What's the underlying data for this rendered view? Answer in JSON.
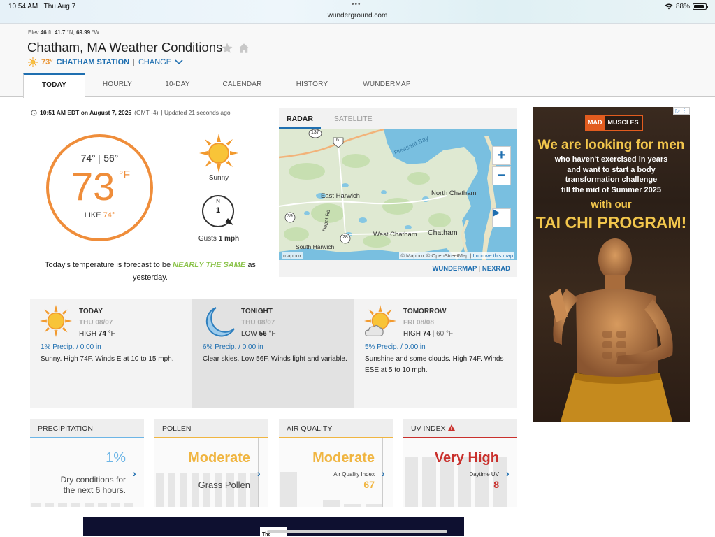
{
  "status_bar": {
    "time": "10:54 AM",
    "date": "Thu Aug 7",
    "url": "wunderground.com",
    "battery": "88%",
    "battery_level": 0.88
  },
  "header": {
    "elev_label": "Elev",
    "elev_value": "46",
    "elev_unit": "ft,",
    "lat": "41.7",
    "lat_unit": "°N,",
    "lon": "69.99",
    "lon_unit": "°W",
    "title": "Chatham, MA Weather Conditions",
    "station_temp": "73°",
    "station_name": "CHATHAM STATION",
    "station_sep": "|",
    "change_label": "CHANGE"
  },
  "tabs": [
    "TODAY",
    "HOURLY",
    "10-DAY",
    "CALENDAR",
    "HISTORY",
    "WUNDERMAP"
  ],
  "current": {
    "updated_time": "10:51 AM EDT on August 7, 2025",
    "tz": "(GMT -4)",
    "updated_ago": "| Updated 21 seconds ago",
    "high": "74°",
    "sep": "|",
    "low": "56°",
    "temp": "73",
    "unit": "°F",
    "like_label": "LIKE",
    "like_value": "74°",
    "condition": "Sunny",
    "wind_dir": "N",
    "wind_speed": "1",
    "gusts_label": "Gusts",
    "gusts_value": "1 mph",
    "note_pre": "Today's temperature is forecast to be",
    "note_hl": "NEARLY THE SAME",
    "note_post": "as yesterday."
  },
  "radar": {
    "tab_radar": "RADAR",
    "tab_satellite": "SATELLITE",
    "labels": {
      "pleasant_bay": "Pleasant Bay",
      "north_chatham": "North Chatham",
      "east_harwich": "East Harwich",
      "depot_rd": "Depot Rd",
      "west_chatham": "West Chatham",
      "chatham": "Chatham",
      "south_harwich": "South Harwich",
      "r137": "137",
      "r6": "6",
      "r39": "39",
      "r28": "28"
    },
    "attribution": "© Mapbox © OpenStreetMap |",
    "improve": "Improve this map",
    "mapbox_logo": "mapbox",
    "link_wundermap": "WUNDERMAP",
    "link_sep": "|",
    "link_nexrad": "NEXRAD"
  },
  "forecast": [
    {
      "period": "TODAY",
      "date": "THU 08/07",
      "hl_label": "HIGH",
      "hl_value": "74",
      "hl_unit": "°F",
      "second": "",
      "precip": "1% Precip. / 0.00 in",
      "desc": "Sunny. High 74F. Winds E at 10 to 15 mph."
    },
    {
      "period": "TONIGHT",
      "date": "THU 08/07",
      "hl_label": "LOW",
      "hl_value": "56",
      "hl_unit": "°F",
      "second": "",
      "precip": "6% Precip. / 0.00 in",
      "desc": "Clear skies. Low 56F. Winds light and variable."
    },
    {
      "period": "TOMORROW",
      "date": "FRI 08/08",
      "hl_label": "HIGH",
      "hl_value": "74",
      "hl_unit": "",
      "second": "| 60 °F",
      "precip": "5% Precip. / 0.00 in",
      "desc": "Sunshine and some clouds. High 74F. Winds ESE at 5 to 10 mph."
    }
  ],
  "tiles": {
    "precip": {
      "title": "PRECIPITATION",
      "value": "1%",
      "sub": "Dry conditions for the next 6 hours.",
      "color": "#6cb5e6"
    },
    "pollen": {
      "title": "POLLEN",
      "value": "Moderate",
      "sub": "Grass Pollen",
      "color": "#f0b541"
    },
    "air": {
      "title": "AIR QUALITY",
      "value": "Moderate",
      "small": "Air Quality Index",
      "num": "67",
      "color": "#f0b541"
    },
    "uv": {
      "title": "UV INDEX",
      "value": "Very High",
      "small": "Daytime UV",
      "num": "8",
      "color": "#c9302c"
    }
  },
  "ad": {
    "logo_a": "MAD",
    "logo_b": "MUSCLES",
    "headline": "We are looking for men",
    "body1": "who haven't exercised in years",
    "body2": "and want to start a body",
    "body3": "transformation challenge",
    "body4": "till the mid of Summer 2025",
    "with": "with our",
    "program": "TAI CHI PROGRAM!",
    "badge": "▷ ⋮"
  },
  "banner": {
    "text": "The"
  },
  "colors": {
    "accent": "#1f6fb0",
    "temp": "#ef8d3a",
    "highlight": "#8bc34a"
  }
}
